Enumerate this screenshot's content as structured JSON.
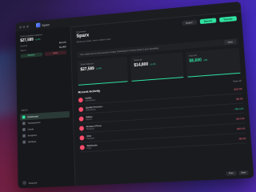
{
  "window": {
    "app_name": "Sparx"
  },
  "sidebar": {
    "balance_label": "Total available balance",
    "balance_value": "$27,589",
    "balance_change": "+2.4%",
    "rows": [
      {
        "label": "Income",
        "value": "$4,120"
      },
      {
        "label": "Spent",
        "value": "$1,860"
      }
    ],
    "receive_label": "Receive",
    "send_label": "Send",
    "menu_label": "MENU",
    "menu_items": [
      {
        "label": "Dashboard",
        "icon": "dashboard-icon",
        "active": true
      },
      {
        "label": "Transactions",
        "icon": "transactions-icon",
        "active": false
      },
      {
        "label": "Cards",
        "icon": "card-icon",
        "active": false
      },
      {
        "label": "Analytics",
        "icon": "analytics-icon",
        "active": false
      },
      {
        "label": "Settings",
        "icon": "gear-icon",
        "active": false
      }
    ],
    "account_label": "Account"
  },
  "header": {
    "eyebrow": "Overview",
    "title": "Sparx",
    "subtitle": "Welcome back, here's what's new",
    "export_label": "Export",
    "deposit_label": "Deposit",
    "transfer_label": "Transfer"
  },
  "notice": {
    "text": "Your statement for this period is ready. Download it to keep track of your spending.",
    "action": "View"
  },
  "stats": [
    {
      "label": "Total balance",
      "value": "$27,589",
      "change": "+2.4%",
      "accent": false
    },
    {
      "label": "Savings",
      "value": "$14,800",
      "change": "+1.1%",
      "accent": false
    },
    {
      "label": "Income",
      "value": "$8,600",
      "change": "+5%",
      "accent": true
    }
  ],
  "activity": {
    "title": "Recent Activity",
    "link": "View all",
    "rows": [
      {
        "title": "Netflix",
        "sub": "Subscription",
        "amount": "-$15.99",
        "positive": false
      },
      {
        "title": "Spotify Premium",
        "sub": "Subscription",
        "amount": "-$9.99",
        "positive": false
      },
      {
        "title": "Salary",
        "sub": "Income",
        "amount": "+$4,120",
        "positive": true
      },
      {
        "title": "Amazon Prime",
        "sub": "Shopping",
        "amount": "-$14.99",
        "positive": false
      },
      {
        "title": "Uber",
        "sub": "Transport",
        "amount": "-$23.40",
        "positive": false
      },
      {
        "title": "Starbucks",
        "sub": "Food",
        "amount": "-$6.50",
        "positive": false
      }
    ]
  },
  "footer": {
    "prev": "Prev",
    "next": "Next"
  },
  "colors": {
    "accent": "#2fe3a1",
    "danger": "#ff4d6d",
    "window_bg": "#1a1b1f"
  }
}
